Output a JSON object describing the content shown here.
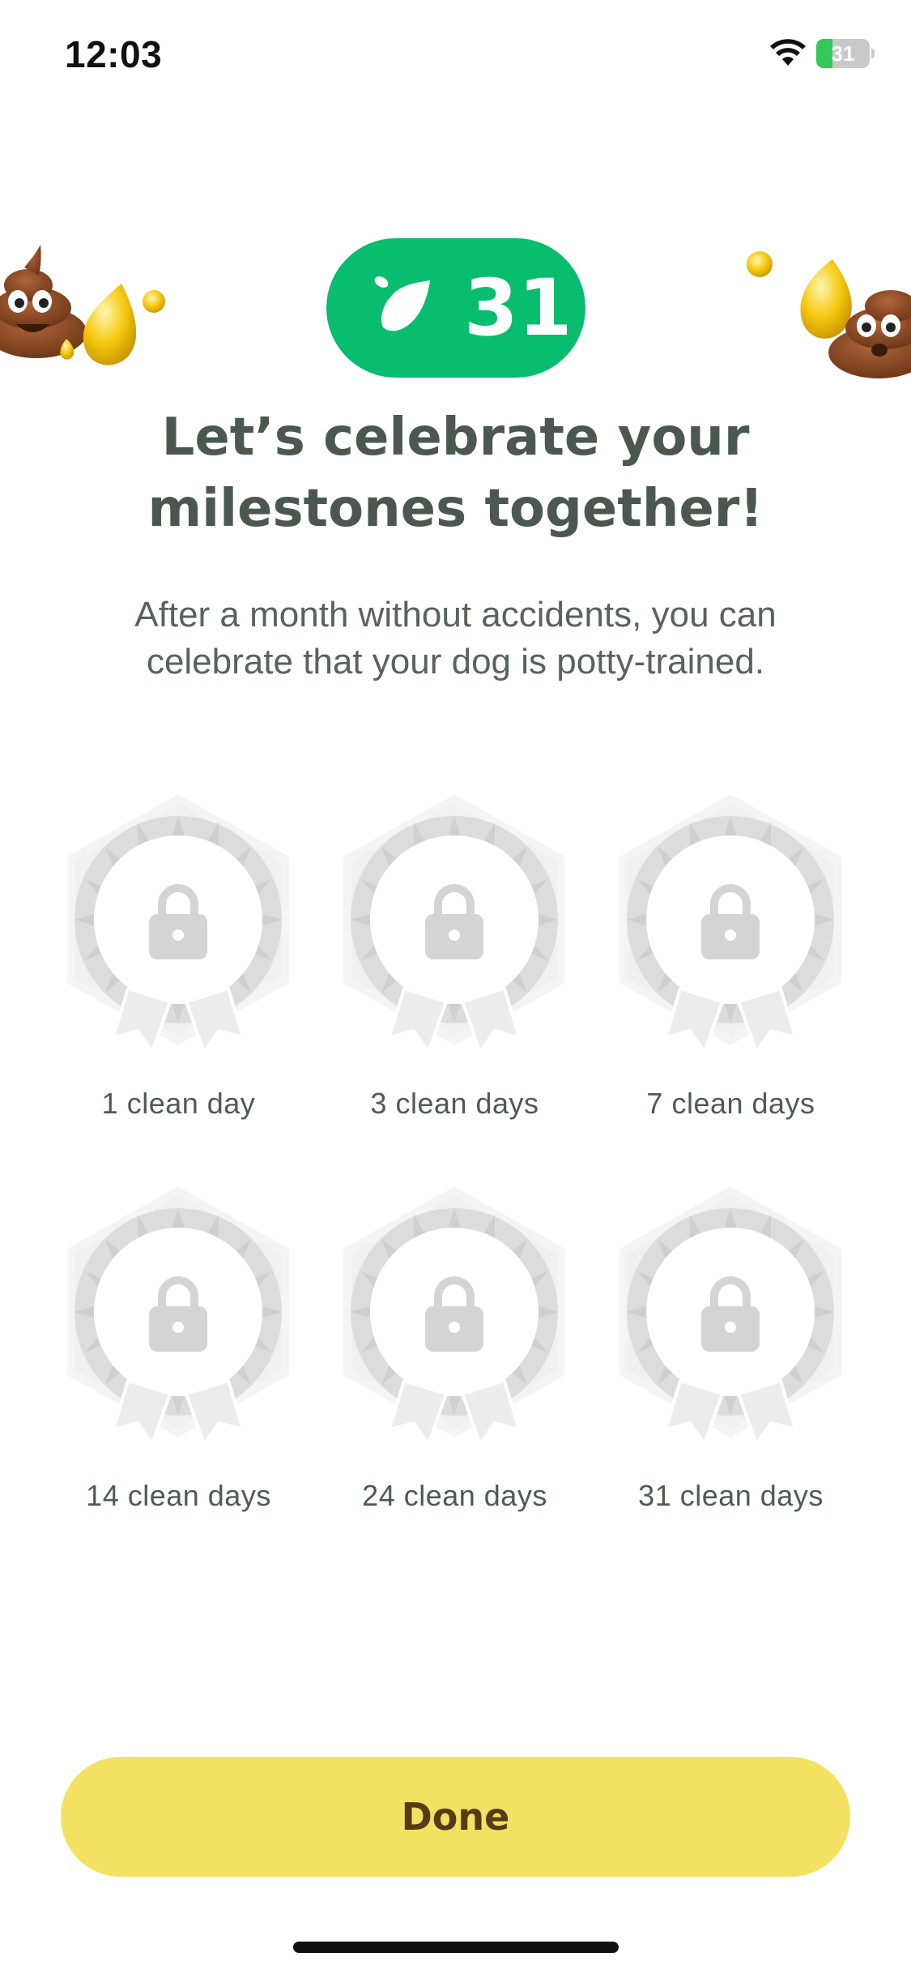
{
  "status_bar": {
    "time": "12:03",
    "battery_level": "31",
    "battery_fraction": 0.31,
    "battery_charging": true
  },
  "streak": {
    "count": "31",
    "icon": "drop-icon",
    "color": "#08bd6e"
  },
  "heading": "Let’s celebrate your milestones together!",
  "subtitle": "After a month without accidents, you can celebrate that your dog is potty-trained.",
  "milestones": [
    {
      "label": "1 clean day",
      "locked": true
    },
    {
      "label": "3 clean days",
      "locked": true
    },
    {
      "label": "7 clean days",
      "locked": true
    },
    {
      "label": "14 clean days",
      "locked": true
    },
    {
      "label": "24 clean days",
      "locked": true
    },
    {
      "label": "31 clean days",
      "locked": true
    }
  ],
  "done_button": {
    "label": "Done",
    "color": "#f3e161"
  },
  "decorations": [
    "poop-emoji",
    "pee-drops"
  ]
}
